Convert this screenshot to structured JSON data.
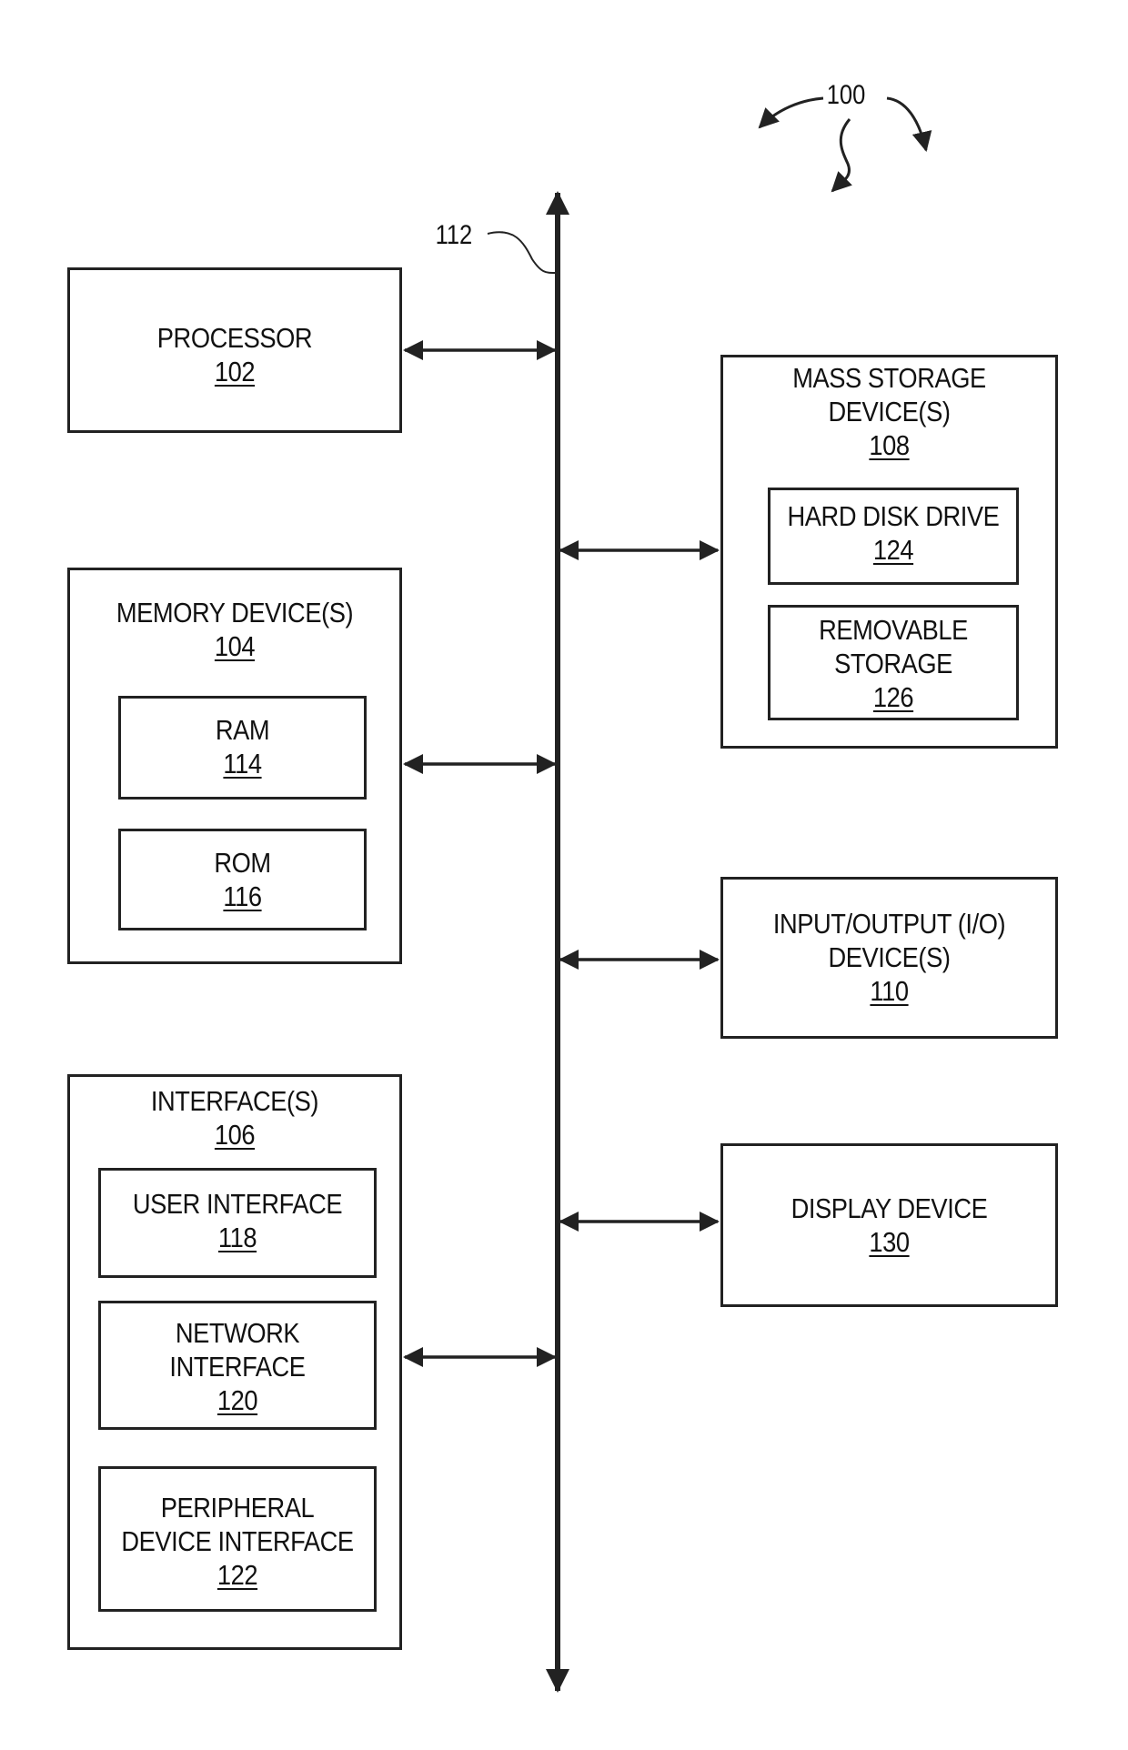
{
  "figure": {
    "reference": "100",
    "bus": {
      "label": "112"
    },
    "blocks": {
      "processor": {
        "title_lines": [
          "PROCESSOR"
        ],
        "ref": "102"
      },
      "memory": {
        "title_lines": [
          "MEMORY DEVICE(S)"
        ],
        "ref": "104",
        "children": [
          {
            "title_lines": [
              "RAM"
            ],
            "ref": "114"
          },
          {
            "title_lines": [
              "ROM"
            ],
            "ref": "116"
          }
        ]
      },
      "interfaces": {
        "title_lines": [
          "INTERFACE(S)"
        ],
        "ref": "106",
        "children": [
          {
            "title_lines": [
              "USER INTERFACE"
            ],
            "ref": "118"
          },
          {
            "title_lines": [
              "NETWORK",
              "INTERFACE"
            ],
            "ref": "120"
          },
          {
            "title_lines": [
              "PERIPHERAL",
              "DEVICE INTERFACE"
            ],
            "ref": "122"
          }
        ]
      },
      "mass_storage": {
        "title_lines": [
          "MASS STORAGE",
          "DEVICE(S)"
        ],
        "ref": "108",
        "children": [
          {
            "title_lines": [
              "HARD DISK DRIVE"
            ],
            "ref": "124"
          },
          {
            "title_lines": [
              "REMOVABLE",
              "STORAGE"
            ],
            "ref": "126"
          }
        ]
      },
      "io": {
        "title_lines": [
          "INPUT/OUTPUT (I/O)",
          "DEVICE(S)"
        ],
        "ref": "110"
      },
      "display": {
        "title_lines": [
          "DISPLAY DEVICE"
        ],
        "ref": "130"
      }
    }
  }
}
